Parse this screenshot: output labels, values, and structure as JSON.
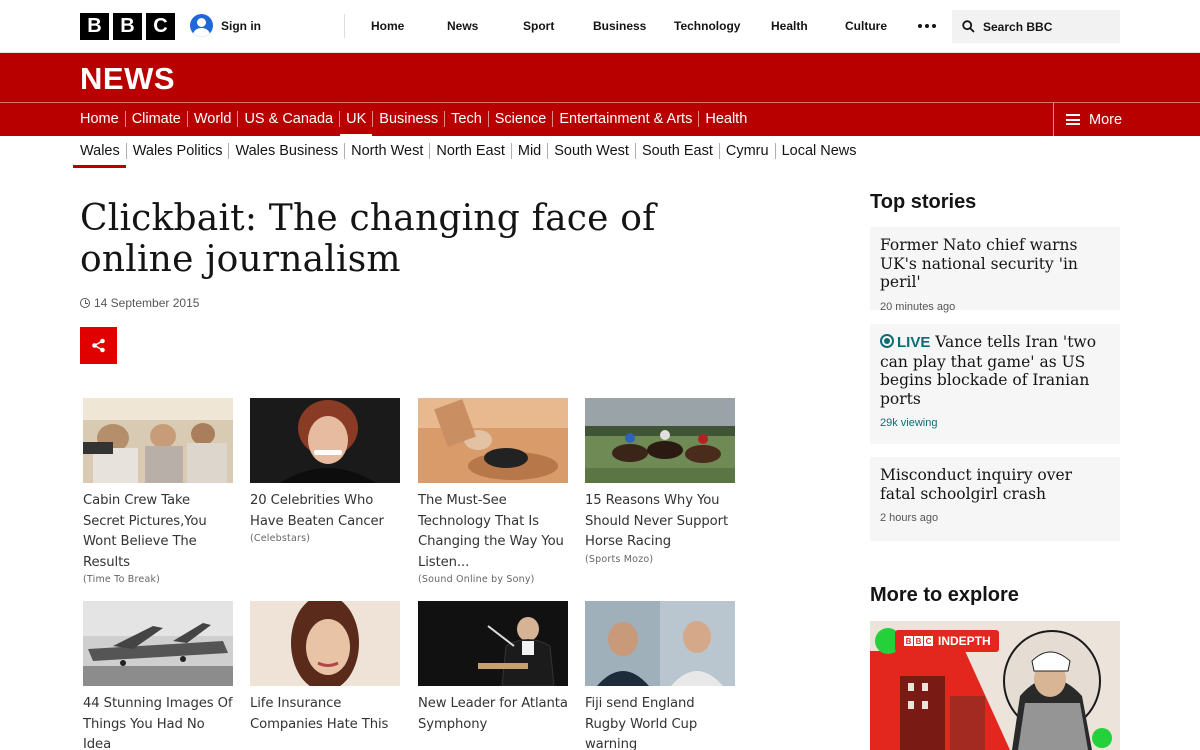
{
  "masthead": {
    "logo_letters": [
      "B",
      "B",
      "C"
    ],
    "signin_label": "Sign in",
    "nav": [
      "Home",
      "News",
      "Sport",
      "Business",
      "Technology",
      "Health",
      "Culture"
    ],
    "search_placeholder": "Search BBC"
  },
  "news": {
    "title": "NEWS",
    "nav": [
      "Home",
      "Climate",
      "World",
      "US & Canada",
      "UK",
      "Business",
      "Tech",
      "Science",
      "Entertainment & Arts",
      "Health"
    ],
    "active": "UK",
    "more_label": "More",
    "brand_color": "#b80000"
  },
  "sub_nav": {
    "items": [
      "Wales",
      "Wales Politics",
      "Wales Business",
      "North West",
      "North East",
      "Mid",
      "South West",
      "South East",
      "Cymru",
      "Local News"
    ],
    "active": "Wales"
  },
  "article": {
    "headline": "Clickbait: The changing face of online journalism",
    "date": "14 September 2015",
    "share_icon": "share-icon"
  },
  "clickbait_grid": [
    {
      "title": "Cabin Crew Take Secret Pictures,You Wont Believe The Results",
      "source": "(Time To Break)"
    },
    {
      "title": "20 Celebrities Who Have Beaten Cancer",
      "source": "(Celebstars)"
    },
    {
      "title": "The Must-See Technology That Is Changing the Way You Listen...",
      "source": "(Sound Online by Sony)"
    },
    {
      "title": "15 Reasons Why You Should Never Support Horse Racing",
      "source": "(Sports Mozo)"
    },
    {
      "title": "44 Stunning Images Of Things You Had No Idea",
      "source": ""
    },
    {
      "title": "Life Insurance Companies Hate This",
      "source": ""
    },
    {
      "title": "New Leader for Atlanta Symphony",
      "source": ""
    },
    {
      "title": "Fiji send England Rugby World Cup warning",
      "source": ""
    }
  ],
  "sidebar": {
    "top_stories_heading": "Top stories",
    "stories": [
      {
        "title": "Former Nato chief warns UK's national security 'in peril'",
        "meta": "20 minutes ago"
      },
      {
        "live_label": "LIVE",
        "title": "Vance tells Iran 'two can play that game' as US begins blockade of Iranian ports",
        "meta": "29k viewing"
      },
      {
        "title": "Misconduct inquiry over fatal schoolgirl crash",
        "meta": "2 hours ago"
      }
    ],
    "explore_heading": "More to explore",
    "explore_tag": "INDEPTH",
    "explore_tag_letters": [
      "B",
      "B",
      "C"
    ]
  }
}
